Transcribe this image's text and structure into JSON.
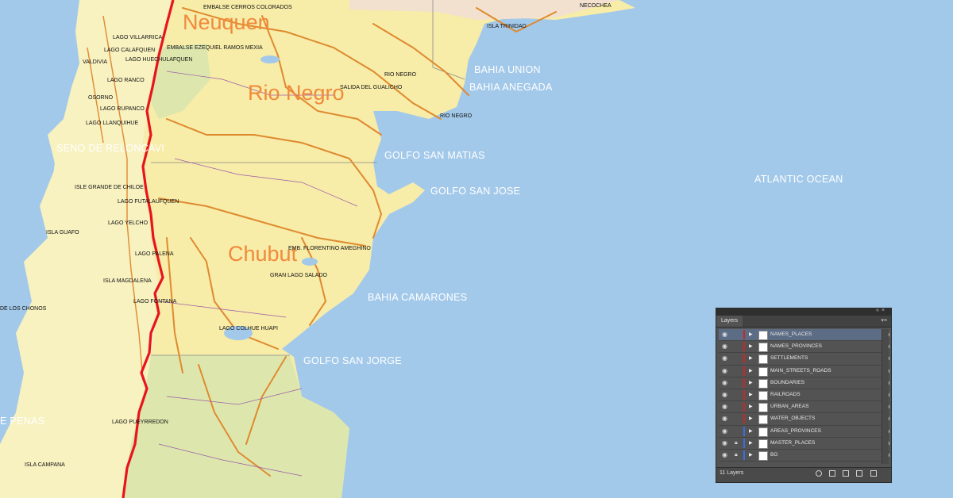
{
  "map": {
    "colors": {
      "ocean": "#a3c9ea",
      "land_chile": "#f8f1c0",
      "land_argentina": "#f7eca8",
      "province_green": "#dde7ad",
      "road": "#df8a2f",
      "border": "#e8141c"
    },
    "ocean_labels": [
      "BAHIA UNION",
      "BAHIA ANEGADA",
      "GOLFO SAN MATIAS",
      "GOLFO SAN JOSE",
      "ATLANTIC OCEAN",
      "BAHIA CAMARONES",
      "GOLFO SAN JORGE",
      "SENO DE RELONCAVI",
      "E PENAS"
    ],
    "province_labels": [
      "Neuquen",
      "Rio Negro",
      "Chubut"
    ],
    "place_labels": [
      "EMBALSE CERROS COLORADOS",
      "EMBALSE EZEQUIEL RAMOS MEXIA",
      "LAGO VILLARRICA",
      "LAGO CALAFQUEN",
      "LAGO HUECHULAFQUEN",
      "VALDIVIA",
      "LAGO RANCO",
      "OSORNO",
      "LAGO RUPANCO",
      "LAGO LLANQUIHUE",
      "RIO NEGRO",
      "SALIDA DEL GUALICHO",
      "RIO NEGRO",
      "ISLA TRINIDAD",
      "NECOCHEA",
      "ISLE GRANDE DE CHILOE",
      "LAGO FUTALAUFQUEN",
      "LAGO YELCHO",
      "ISLA GUAFO",
      "LAGO PALENA",
      "EMB. FLORENTINO AMEGHINO",
      "GRAN LAGO SALADO",
      "ISLA MAGDALENA",
      "LAGO FONTANA",
      "DE LOS CHONOS",
      "LAGO COLHUE HUAPI",
      "LAGO PUEYRREDON",
      "ISLA CAMPANA"
    ]
  },
  "layers_panel": {
    "tab": "Layers",
    "collapse_icon": "double-chevron-icon",
    "count_label": "11 Layers",
    "layers": [
      {
        "name": "NAMES_PLACES",
        "color": "#c62828",
        "selected": true,
        "locked": false
      },
      {
        "name": "NAMES_PROVINCES",
        "color": "#c62828",
        "selected": false,
        "locked": false
      },
      {
        "name": "SETTLEMENTS",
        "color": "#c62828",
        "selected": false,
        "locked": false
      },
      {
        "name": "MAIN_STREETS_ROADS",
        "color": "#c62828",
        "selected": false,
        "locked": false
      },
      {
        "name": "BOUNDARIES",
        "color": "#c62828",
        "selected": false,
        "locked": false
      },
      {
        "name": "RAILROADS",
        "color": "#c62828",
        "selected": false,
        "locked": false
      },
      {
        "name": "URBAN_AREAS",
        "color": "#c62828",
        "selected": false,
        "locked": false
      },
      {
        "name": "WATER_OBJECTS",
        "color": "#c62828",
        "selected": false,
        "locked": false
      },
      {
        "name": "AREAS_PROVINCES",
        "color": "#3a6ee0",
        "selected": false,
        "locked": false
      },
      {
        "name": "MASTER_PLACES",
        "color": "#3a6ee0",
        "selected": false,
        "locked": true
      },
      {
        "name": "BG",
        "color": "#3a6ee0",
        "selected": false,
        "locked": true
      }
    ],
    "footer_icons": [
      "locate-object-icon",
      "make-clipping-mask-icon",
      "new-sublayer-icon",
      "new-layer-icon",
      "delete-layer-icon"
    ]
  }
}
